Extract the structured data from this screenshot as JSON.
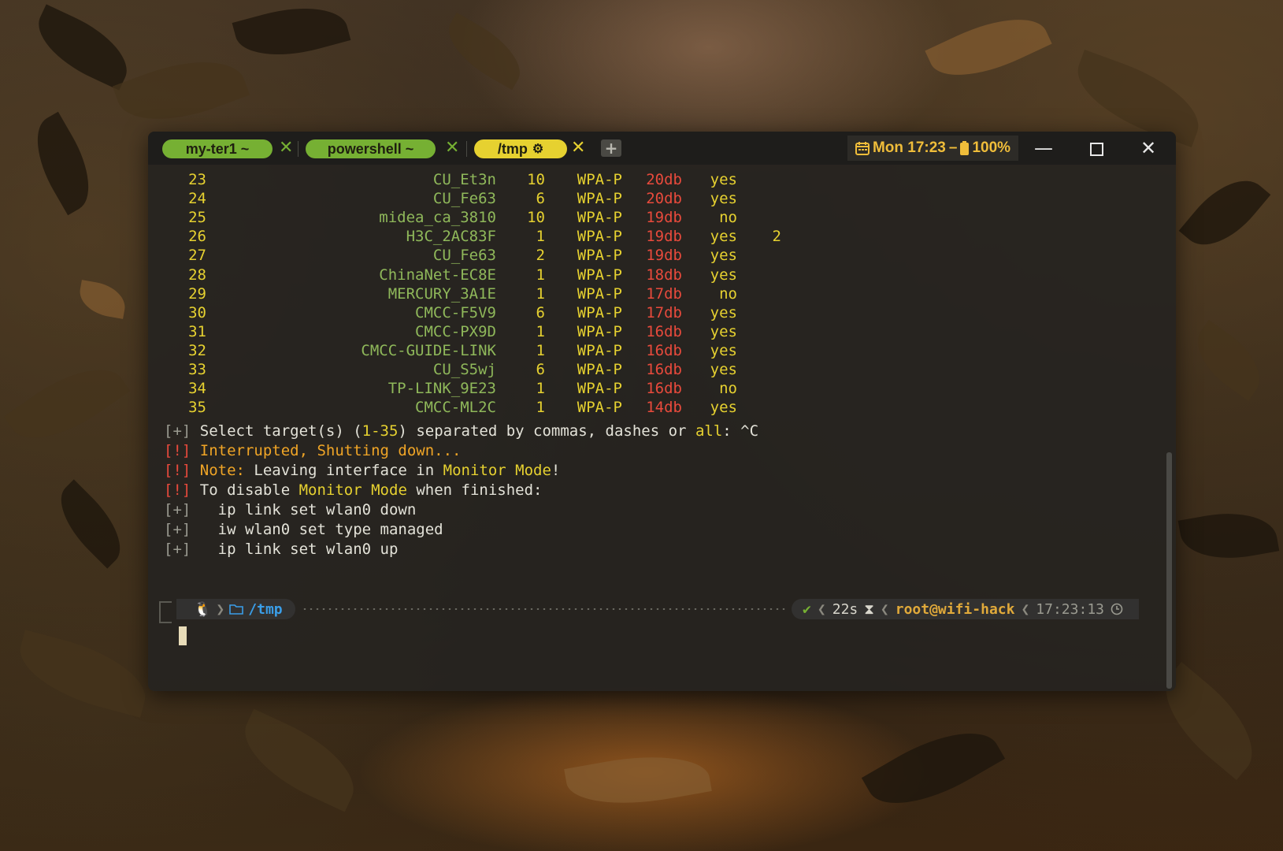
{
  "tabs": [
    {
      "label": "my-ter1 ~",
      "close": "✕"
    },
    {
      "label": "powershell ~",
      "close": "✕"
    },
    {
      "label": "/tmp",
      "close": "✕",
      "active_icon": "gear-icon"
    }
  ],
  "new_tab_label": "+",
  "status_bar": {
    "day_time": "Mon 17:23",
    "separator": "–",
    "battery": "100%"
  },
  "window_controls": {
    "minimize": "—",
    "close": "✕"
  },
  "colors": {
    "tab_inactive": "#76b033",
    "tab_active": "#e6d130",
    "power": "#e84a3c",
    "ssid": "#8fb85a",
    "dir": "#3a9ee8",
    "host": "#e0a93a"
  },
  "networks": [
    {
      "num": "23",
      "ssid": "CU_Et3n",
      "ch": "10",
      "enc": "WPA-P",
      "power": "20db",
      "wps": "yes",
      "clients": ""
    },
    {
      "num": "24",
      "ssid": "CU_Fe63",
      "ch": "6",
      "enc": "WPA-P",
      "power": "20db",
      "wps": "yes",
      "clients": ""
    },
    {
      "num": "25",
      "ssid": "midea_ca_3810",
      "ch": "10",
      "enc": "WPA-P",
      "power": "19db",
      "wps": "no",
      "clients": ""
    },
    {
      "num": "26",
      "ssid": "H3C_2AC83F",
      "ch": "1",
      "enc": "WPA-P",
      "power": "19db",
      "wps": "yes",
      "clients": "2"
    },
    {
      "num": "27",
      "ssid": "CU_Fe63",
      "ch": "2",
      "enc": "WPA-P",
      "power": "19db",
      "wps": "yes",
      "clients": ""
    },
    {
      "num": "28",
      "ssid": "ChinaNet-EC8E",
      "ch": "1",
      "enc": "WPA-P",
      "power": "18db",
      "wps": "yes",
      "clients": ""
    },
    {
      "num": "29",
      "ssid": "MERCURY_3A1E",
      "ch": "1",
      "enc": "WPA-P",
      "power": "17db",
      "wps": "no",
      "clients": ""
    },
    {
      "num": "30",
      "ssid": "CMCC-F5V9",
      "ch": "6",
      "enc": "WPA-P",
      "power": "17db",
      "wps": "yes",
      "clients": ""
    },
    {
      "num": "31",
      "ssid": "CMCC-PX9D",
      "ch": "1",
      "enc": "WPA-P",
      "power": "16db",
      "wps": "yes",
      "clients": ""
    },
    {
      "num": "32",
      "ssid": "CMCC-GUIDE-LINK",
      "ch": "1",
      "enc": "WPA-P",
      "power": "16db",
      "wps": "yes",
      "clients": ""
    },
    {
      "num": "33",
      "ssid": "CU_S5wj",
      "ch": "6",
      "enc": "WPA-P",
      "power": "16db",
      "wps": "yes",
      "clients": ""
    },
    {
      "num": "34",
      "ssid": "TP-LINK_9E23",
      "ch": "1",
      "enc": "WPA-P",
      "power": "16db",
      "wps": "no",
      "clients": ""
    },
    {
      "num": "35",
      "ssid": "CMCC-ML2C",
      "ch": "1",
      "enc": "WPA-P",
      "power": "14db",
      "wps": "yes",
      "clients": ""
    }
  ],
  "messages": {
    "select": {
      "prefix": "[+]",
      "text_a": " Select target(s) (",
      "range": "1-35",
      "text_b": ") separated by commas, dashes or ",
      "all": "all",
      "text_c": ": ^C"
    },
    "interrupted": {
      "prefix": "[!]",
      "text": " Interrupted, Shutting down..."
    },
    "note": {
      "prefix": "[!]",
      "label": " Note:",
      "text_a": " Leaving interface in ",
      "mode": "Monitor Mode",
      "text_b": "!"
    },
    "disable": {
      "prefix": "[!]",
      "text_a": " To disable ",
      "mode": "Monitor Mode",
      "text_b": " when finished:"
    },
    "commands": [
      {
        "prefix": "[+]",
        "text": "   ip link set wlan0 down"
      },
      {
        "prefix": "[+]",
        "text": "   iw wlan0 set type managed"
      },
      {
        "prefix": "[+]",
        "text": "   ip link set wlan0 up"
      }
    ]
  },
  "prompt": {
    "os_icon": "linux-penguin-icon",
    "folder_icon": "folder-icon",
    "dir": "/tmp",
    "status_icon": "check-icon",
    "duration": "22s",
    "duration_icon": "hourglass-icon",
    "user_host": "root@wifi-hack",
    "time": "17:23:13",
    "time_icon": "clock-icon"
  }
}
